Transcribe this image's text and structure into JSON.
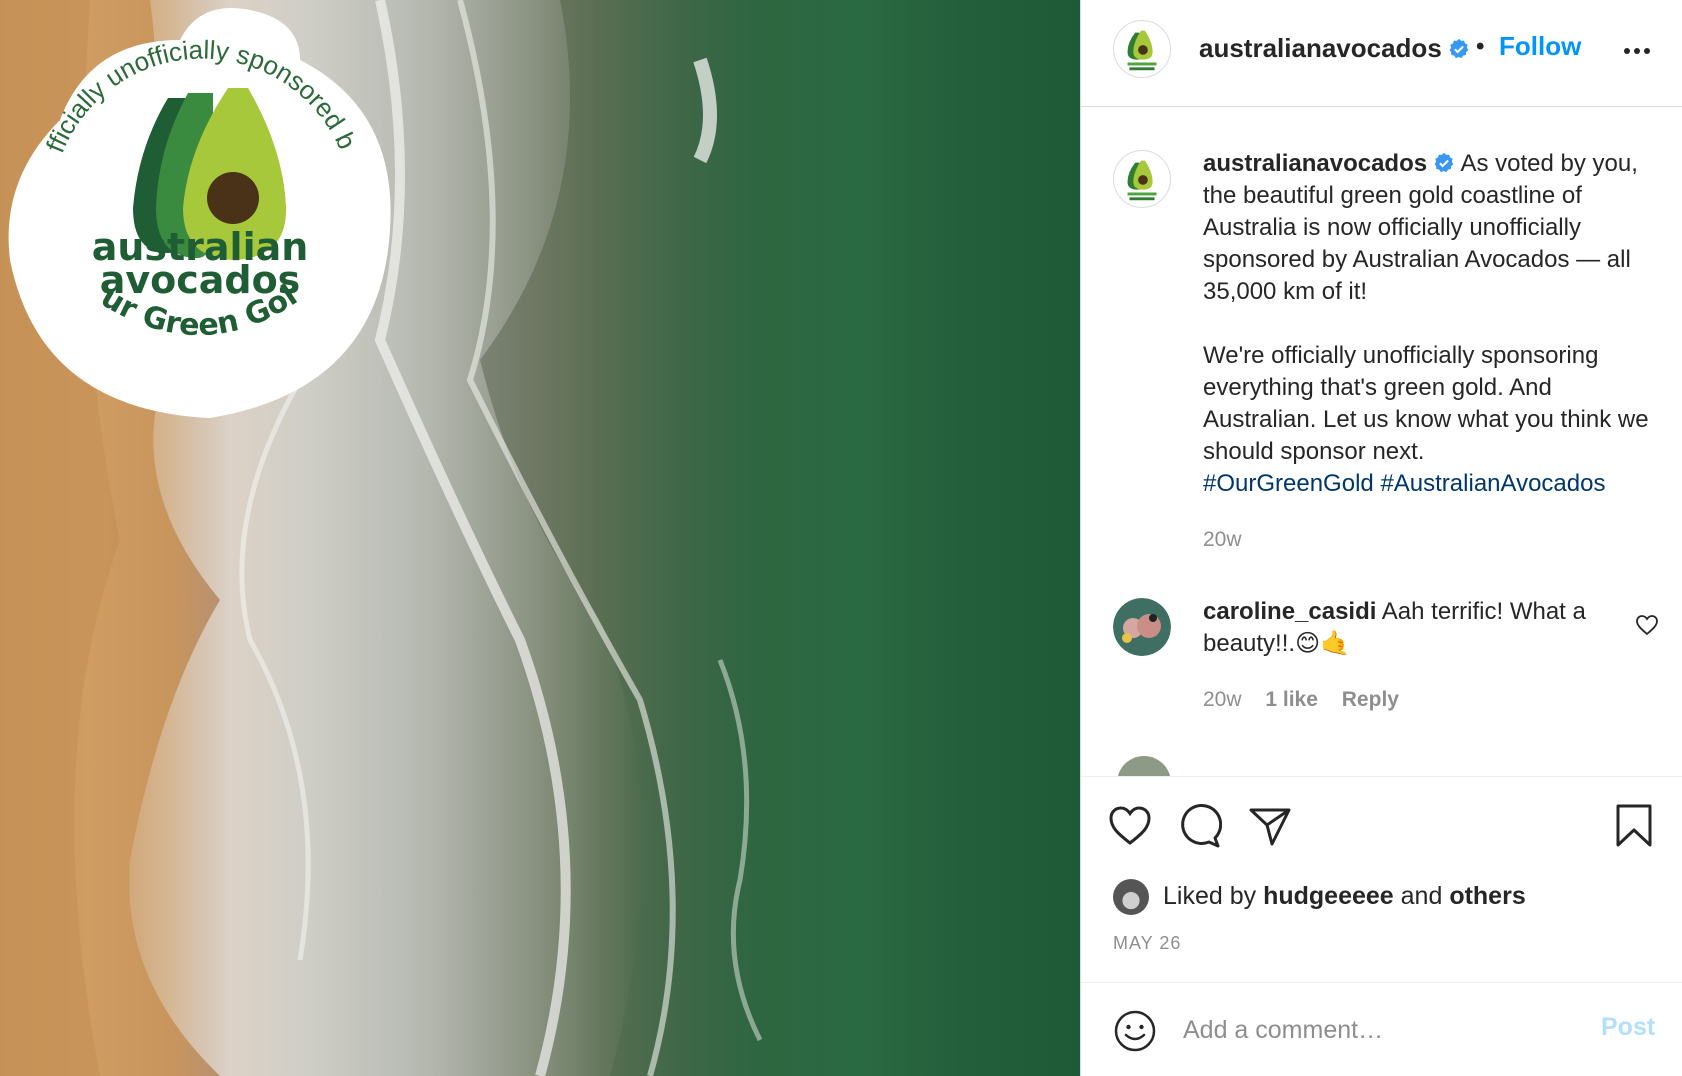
{
  "post": {
    "username": "australianavocados",
    "follow_label": "Follow",
    "header_separator": "•"
  },
  "sticker": {
    "arc_text": "Officially unofficially sponsored by",
    "brand_line1": "australian",
    "brand_line2": "avocados",
    "tagline": "Our Green Gold"
  },
  "caption": {
    "username": "australianavocados",
    "paragraph1": "As voted by you, the beautiful green gold coastline of Australia is now officially unofficially sponsored by Australian Avocados — all 35,000 km of it!",
    "paragraph2": "We're officially unofficially sponsoring everything that's green gold. And Australian. Let us know what you think we should sponsor next.",
    "hashtag1": "#OurGreenGold",
    "hashtag2": "#AustralianAvocados",
    "time": "20w"
  },
  "comments": [
    {
      "username": "caroline_casidi",
      "text": "Aah terrific! What a beauty!!.😊🤙",
      "time": "20w",
      "likes": "1 like",
      "reply_label": "Reply"
    }
  ],
  "likes": {
    "prefix": "Liked by",
    "user": "hudgeeeee",
    "connector": "and",
    "others": "others"
  },
  "date": "MAY 26",
  "add_comment": {
    "placeholder": "Add a comment…",
    "post_label": "Post"
  },
  "colors": {
    "accent": "#0095f6",
    "post_disabled": "#b2dffc",
    "hashtag": "#00376b",
    "brand_dark_green": "#1f5e34",
    "brand_light_green": "#a6c83a"
  },
  "icons": [
    "verified-badge-icon",
    "more-options-icon",
    "heart-icon",
    "comment-icon",
    "share-icon",
    "bookmark-icon",
    "emoji-icon"
  ]
}
